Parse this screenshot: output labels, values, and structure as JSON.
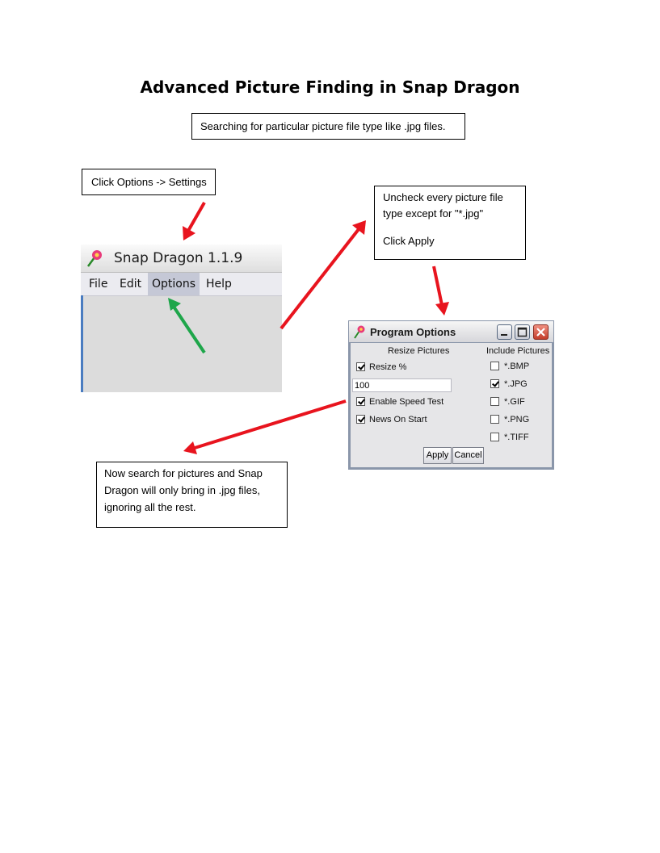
{
  "page_title": "Advanced Picture Finding in Snap Dragon",
  "subtitle": "Searching for particular picture file type like .jpg files.",
  "step1": "Click Options -> Settings",
  "step2": {
    "line1": "Uncheck every picture file",
    "line2": "type except for \"*.jpg\"",
    "line3": "Click Apply"
  },
  "step3": {
    "line1": "Now search for pictures and Snap",
    "line2": "Dragon will only bring in .jpg files,",
    "line3": "ignoring all the rest."
  },
  "app_window": {
    "title": "Snap Dragon 1.1.9",
    "icon": "flower-icon",
    "menu": [
      "File",
      "Edit",
      "Options",
      "Help"
    ],
    "active_menu": "Options"
  },
  "dialog": {
    "title": "Program Options",
    "icon": "flower-icon",
    "resize_header": "Resize Pictures",
    "include_header": "Include Pictures",
    "resize_label": "Resize %",
    "resize_checked": true,
    "resize_value": "100",
    "speed_test_label": "Enable Speed Test",
    "speed_test_checked": true,
    "news_label": "News On Start",
    "news_checked": true,
    "types": [
      {
        "label": "*.BMP",
        "checked": false
      },
      {
        "label": "*.JPG",
        "checked": true
      },
      {
        "label": "*.GIF",
        "checked": false
      },
      {
        "label": "*.PNG",
        "checked": false
      },
      {
        "label": "*.TIFF",
        "checked": false
      }
    ],
    "apply_label": "Apply",
    "cancel_label": "Cancel"
  },
  "colors": {
    "arrow_red": "#e8141e",
    "arrow_green": "#1ea64a"
  }
}
